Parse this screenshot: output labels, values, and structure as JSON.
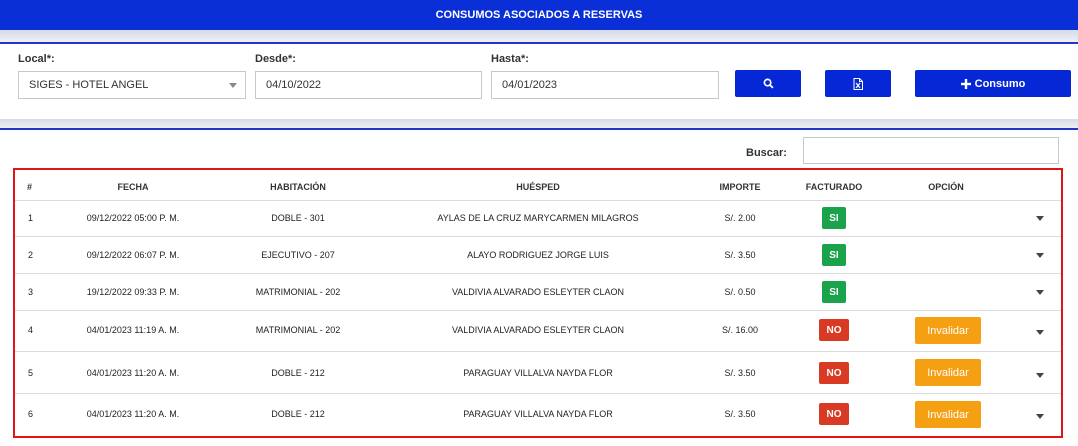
{
  "header": {
    "title": "CONSUMOS ASOCIADOS A RESERVAS"
  },
  "filters": {
    "local_label": "Local*:",
    "local_value": "SIGES - HOTEL ANGEL",
    "desde_label": "Desde*:",
    "desde_value": "04/10/2022",
    "hasta_label": "Hasta*:",
    "hasta_value": "04/01/2023"
  },
  "actions": {
    "search_icon": "search-icon",
    "excel_icon": "excel-icon",
    "consumo_label": "Consumo"
  },
  "search": {
    "label": "Buscar:",
    "value": ""
  },
  "table": {
    "columns": [
      "#",
      "FECHA",
      "HABITACIÓN",
      "HUÉSPED",
      "IMPORTE",
      "FACTURADO",
      "OPCIÓN"
    ],
    "rows": [
      {
        "num": "1",
        "fecha": "09/12/2022 05:00 P. M.",
        "habitacion": "DOBLE - 301",
        "huesped": "AYLAS DE LA CRUZ MARYCARMEN MILAGROS",
        "importe": "S/. 2.00",
        "facturado": "SI",
        "opcion": ""
      },
      {
        "num": "2",
        "fecha": "09/12/2022 06:07 P. M.",
        "habitacion": "EJECUTIVO - 207",
        "huesped": "ALAYO RODRIGUEZ JORGE LUIS",
        "importe": "S/. 3.50",
        "facturado": "SI",
        "opcion": ""
      },
      {
        "num": "3",
        "fecha": "19/12/2022 09:33 P. M.",
        "habitacion": "MATRIMONIAL - 202",
        "huesped": "VALDIVIA ALVARADO ESLEYTER CLAON",
        "importe": "S/. 0.50",
        "facturado": "SI",
        "opcion": ""
      },
      {
        "num": "4",
        "fecha": "04/01/2023 11:19 A. M.",
        "habitacion": "MATRIMONIAL - 202",
        "huesped": "VALDIVIA ALVARADO ESLEYTER CLAON",
        "importe": "S/. 16.00",
        "facturado": "NO",
        "opcion": "Invalidar"
      },
      {
        "num": "5",
        "fecha": "04/01/2023 11:20 A. M.",
        "habitacion": "DOBLE - 212",
        "huesped": "PARAGUAY VILLALVA NAYDA FLOR",
        "importe": "S/. 3.50",
        "facturado": "NO",
        "opcion": "Invalidar"
      },
      {
        "num": "6",
        "fecha": "04/01/2023 11:20 A. M.",
        "habitacion": "DOBLE - 212",
        "huesped": "PARAGUAY VILLALVA NAYDA FLOR",
        "importe": "S/. 3.50",
        "facturado": "NO",
        "opcion": "Invalidar"
      }
    ]
  },
  "colors": {
    "primary": "#0527d6",
    "si": "#1aa34a",
    "no": "#d83a24",
    "invalidar": "#f59f12",
    "highlight_frame": "#e01616"
  }
}
